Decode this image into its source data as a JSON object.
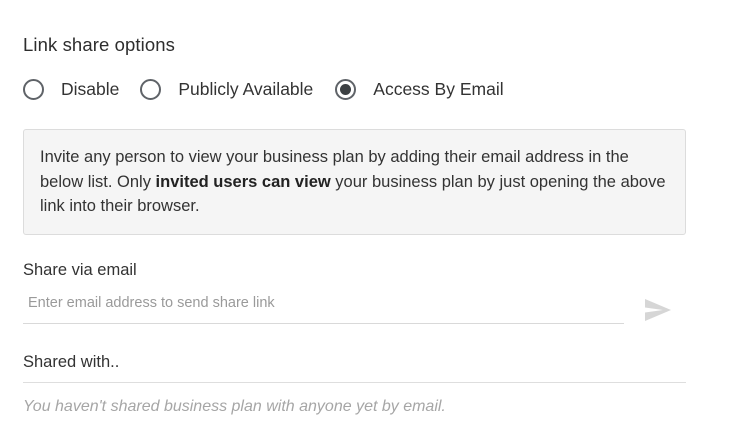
{
  "link_share": {
    "title": "Link share options",
    "options": [
      {
        "label": "Disable",
        "selected": false
      },
      {
        "label": "Publicly Available",
        "selected": false
      },
      {
        "label": "Access By Email",
        "selected": true
      }
    ]
  },
  "info": {
    "text_before": "Invite any person to view your business plan by adding their email address in the below list. Only ",
    "text_bold": "invited users can view",
    "text_after": " your business plan by just opening the above link into their browser."
  },
  "share_email": {
    "label": "Share via email",
    "input_value": "",
    "placeholder": "Enter email address to send share link",
    "send_icon": "send-icon"
  },
  "shared_with": {
    "label": "Shared with..",
    "empty_message": "You haven't shared business plan with anyone yet by email."
  },
  "colors": {
    "radio_border": "#5f6368",
    "info_background": "#f5f5f5",
    "send_icon": "#d6d6d6",
    "muted_text": "#a6a6a6"
  }
}
